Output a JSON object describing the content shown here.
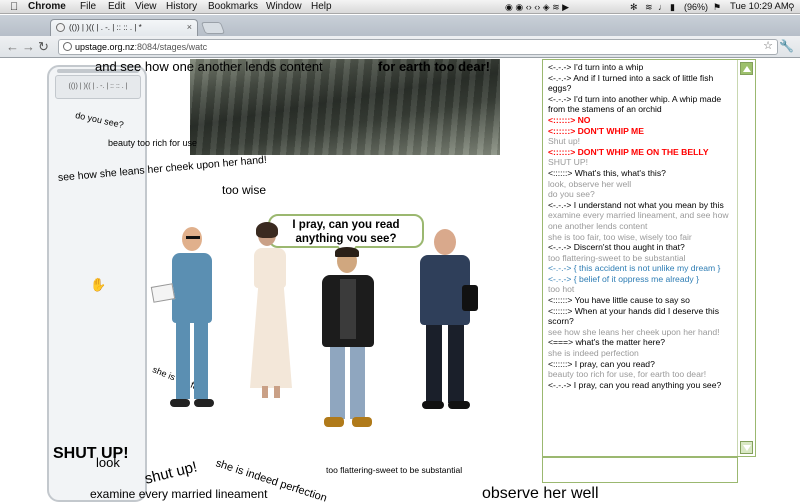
{
  "menubar": {
    "app": "Chrome",
    "menus": [
      "File",
      "Edit",
      "View",
      "History",
      "Bookmarks",
      "Window",
      "Help"
    ],
    "battery": "(96%)",
    "clock": "Tue 10:29 AM"
  },
  "browser": {
    "tab_title": "(()) | )(( | . -. | :: :: . | *",
    "url_host": "upstage.org.nz",
    "url_rest": ":8084/stages/watc"
  },
  "sidepanel": {
    "header": "(()) | )(( | . -. | :: :: . |"
  },
  "stage_text": [
    {
      "id": "t1",
      "text": "and see how one another lends content"
    },
    {
      "id": "t2",
      "text": "for earth too dear!"
    },
    {
      "id": "t3",
      "text": "do you see?"
    },
    {
      "id": "t4",
      "text": "beauty too rich for use"
    },
    {
      "id": "t5",
      "text": "see how she leans her cheek upon her hand!"
    },
    {
      "id": "t6",
      "text": "too wise"
    },
    {
      "id": "t7",
      "text": "she is too fair"
    },
    {
      "id": "t8",
      "text": "SHUT UP!"
    },
    {
      "id": "t9",
      "text": "look"
    },
    {
      "id": "t10",
      "text": "shut up!"
    },
    {
      "id": "t11",
      "text": "she is indeed perfection"
    },
    {
      "id": "t12",
      "text": "too flattering-sweet to be substantial"
    },
    {
      "id": "t13",
      "text": "examine every married lineament"
    },
    {
      "id": "t14",
      "text": "observe her well"
    }
  ],
  "bubble": "I pray, can you read anything you see?",
  "colors": {
    "accent_green": "#9bb870",
    "shout_red": "#ff0000",
    "system_grey": "#9a9a9a",
    "blue_line": "#2e7db4"
  },
  "chat": [
    {
      "text": "<-.-.-> I'd turn into a whip",
      "style": "normal"
    },
    {
      "text": "<-.-.-> And if I turned into a sack of little fish eggs?",
      "style": "normal"
    },
    {
      "text": "<-.-.-> I'd turn into another whip. A whip made from the stamens of an orchid",
      "style": "normal"
    },
    {
      "text": "<::::::> NO",
      "style": "red"
    },
    {
      "text": "<::::::> DON'T WHIP ME",
      "style": "red"
    },
    {
      "text": "Shut up!",
      "style": "grey"
    },
    {
      "text": "<::::::> DON'T WHIP ME ON THE BELLY",
      "style": "red"
    },
    {
      "text": "SHUT UP!",
      "style": "grey"
    },
    {
      "text": "<::::::> What's this, what's this?",
      "style": "normal"
    },
    {
      "text": "look, observe her well",
      "style": "grey"
    },
    {
      "text": "do you see?",
      "style": "grey"
    },
    {
      "text": "<-.-.-> I understand not what you mean by this",
      "style": "normal"
    },
    {
      "text": "examine every married lineament, and see how one another lends content",
      "style": "grey"
    },
    {
      "text": "she is too fair, too wise, wisely too fair",
      "style": "grey"
    },
    {
      "text": "<-.-.-> Discern'st thou aught in that?",
      "style": "normal"
    },
    {
      "text": "too flattering-sweet to be substantial",
      "style": "grey"
    },
    {
      "text": "<-.-.-> { this accident is not unlike my dream }",
      "style": "blue"
    },
    {
      "text": "<-.-.-> { belief of it oppress me already }",
      "style": "blue"
    },
    {
      "text": "too hot",
      "style": "grey"
    },
    {
      "text": "<::::::> You have little cause to say so",
      "style": "normal"
    },
    {
      "text": "<::::::> When at your hands did I deserve this scorn?",
      "style": "normal"
    },
    {
      "text": "see how she leans her cheek upon her hand!",
      "style": "grey"
    },
    {
      "text": "<===> what's the matter here?",
      "style": "normal"
    },
    {
      "text": "she is indeed perfection",
      "style": "grey"
    },
    {
      "text": "<::::::> I pray, can you read?",
      "style": "normal"
    },
    {
      "text": "beauty too rich for use, for earth too dear!",
      "style": "grey"
    },
    {
      "text": "<-.-.-> I pray, can you read anything you see?",
      "style": "normal"
    }
  ]
}
